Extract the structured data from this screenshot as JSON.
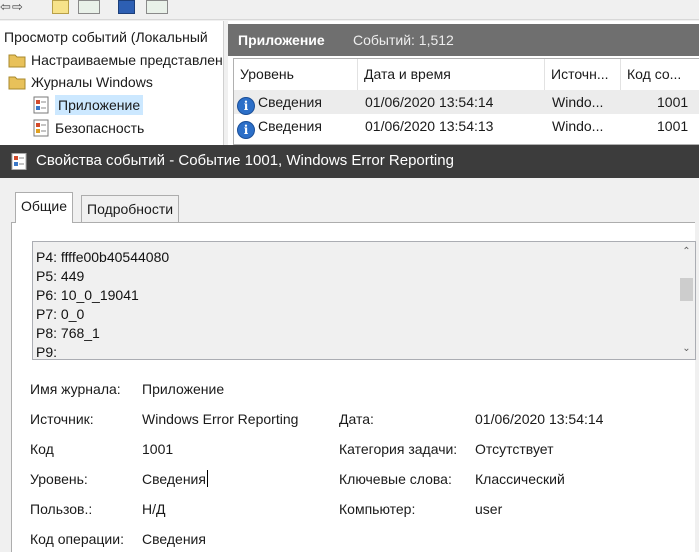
{
  "event_viewer": {
    "tree": {
      "items": [
        {
          "label": "Просмотр событий (Локальный"
        },
        {
          "label": "Настраиваемые представлен"
        },
        {
          "label": "Журналы Windows"
        },
        {
          "label": "Приложение"
        },
        {
          "label": "Безопасность"
        }
      ]
    },
    "list": {
      "title": "Приложение",
      "count": "Событий: 1,512",
      "columns": [
        "Уровень",
        "Дата и время",
        "Источн...",
        "Код со..."
      ],
      "rows": [
        {
          "level": "Сведения",
          "datetime": "01/06/2020 13:54:14",
          "source": "Windo...",
          "code": "1001"
        },
        {
          "level": "Сведения",
          "datetime": "01/06/2020 13:54:13",
          "source": "Windo...",
          "code": "1001"
        }
      ]
    }
  },
  "dialog": {
    "title": "Свойства событий - Событие 1001, Windows Error Reporting",
    "tabs": [
      {
        "label": "Общие"
      },
      {
        "label": "Подробности"
      }
    ],
    "description_lines": [
      "P4: ffffe00b40544080",
      "P5: 449",
      "P6: 10_0_19041",
      "P7: 0_0",
      "P8: 768_1",
      "P9:"
    ],
    "fields": {
      "log_name": {
        "label": "Имя журнала:",
        "value": "Приложение"
      },
      "source": {
        "label": "Источник:",
        "value": "Windows Error Reporting"
      },
      "date": {
        "label": "Дата:",
        "value": "01/06/2020 13:54:14"
      },
      "code": {
        "label": "Код",
        "value": "1001"
      },
      "task_category": {
        "label": "Категория задачи:",
        "value": "Отсутствует"
      },
      "level": {
        "label": "Уровень:",
        "value": "Сведения"
      },
      "keywords": {
        "label": "Ключевые слова:",
        "value": "Классический"
      },
      "user": {
        "label": "Пользов.:",
        "value": "Н/Д"
      },
      "computer": {
        "label": "Компьютер:",
        "value": "user"
      },
      "opcode": {
        "label": "Код операции:",
        "value": "Сведения"
      }
    }
  },
  "icons": {
    "info": "info-icon",
    "log": "log-icon",
    "folder": "folder-icon",
    "back": "back-arrow-icon",
    "forward": "forward-arrow-icon"
  },
  "colors": {
    "list_header_bg": "#6f6f6f",
    "dialog_titlebar_bg": "#3c3c3c",
    "selection": "#cce8ff",
    "info_blue": "#2c6fc8"
  }
}
